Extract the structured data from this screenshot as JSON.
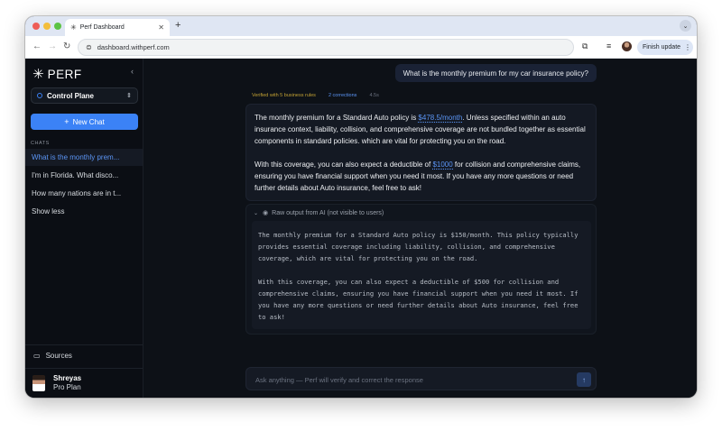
{
  "browser": {
    "tab_title": "Perf Dashboard",
    "url": "dashboard.withperf.com",
    "update_label": "Finish update",
    "colors": {
      "tab_bar": "#dfe6f3",
      "toolbar": "#ffffff"
    }
  },
  "sidebar": {
    "logo_text": "PERF",
    "workspace": "Control Plane",
    "new_chat_label": "New Chat",
    "chats_heading": "CHATS",
    "chats": [
      "What is the monthly prem...",
      "I'm in Florida. What disco...",
      "How many nations are in t..."
    ],
    "show_less_label": "Show less",
    "sources_label": "Sources",
    "user": {
      "name": "Shreyas",
      "plan": "Pro Plan"
    }
  },
  "conversation": {
    "user_message": "What is the monthly premium for my car insurance policy?",
    "meta": {
      "verified": "Verified with 5 business rules",
      "corrections": "2 corrections",
      "time": "4.5s"
    },
    "answer": {
      "p1_before": "The monthly premium for a Standard Auto policy is ",
      "p1_highlight": "$478.5/month",
      "p1_after": ". Unless specified within an auto insurance context, liability, collision, and comprehensive coverage are not bundled together as essential components in standard policies. which are vital for protecting you on the road.",
      "p2_before": "With this coverage, you can also expect a deductible of ",
      "p2_highlight": "$1000",
      "p2_after": " for collision and comprehensive claims, ensuring you have financial support when you need it most. If you have any more questions or need further details about Auto insurance, feel free to ask!"
    },
    "raw_output": {
      "label": "Raw output from AI (not visible to users)",
      "p1": "The monthly premium for a Standard Auto policy is $150/month. This policy typically provides essential coverage including liability, collision, and comprehensive coverage, which are vital for protecting you on the road.",
      "p2": "With this coverage, you can also expect a deductible of $500 for collision and comprehensive claims, ensuring you have financial support when you need it most. If you have any more questions or need further details about Auto insurance, feel free to ask!"
    }
  },
  "composer": {
    "placeholder": "Ask anything — Perf will verify and correct the response",
    "value": ""
  },
  "colors": {
    "accent": "#3b82f6",
    "highlight_text": "#5b95f5",
    "verified": "#c2a133",
    "background": "#0d1117",
    "sidebar": "#0b0e14"
  },
  "icons": {
    "tab_favicon": "sparkle-icon",
    "site_info": "site-info-icon",
    "collapse": "chevron-left-icon",
    "workspace": "ring-icon",
    "sources": "folder-icon",
    "raw_toggle": "chevron-down-icon",
    "raw_visibility": "eye-icon",
    "send": "arrow-up-icon"
  }
}
